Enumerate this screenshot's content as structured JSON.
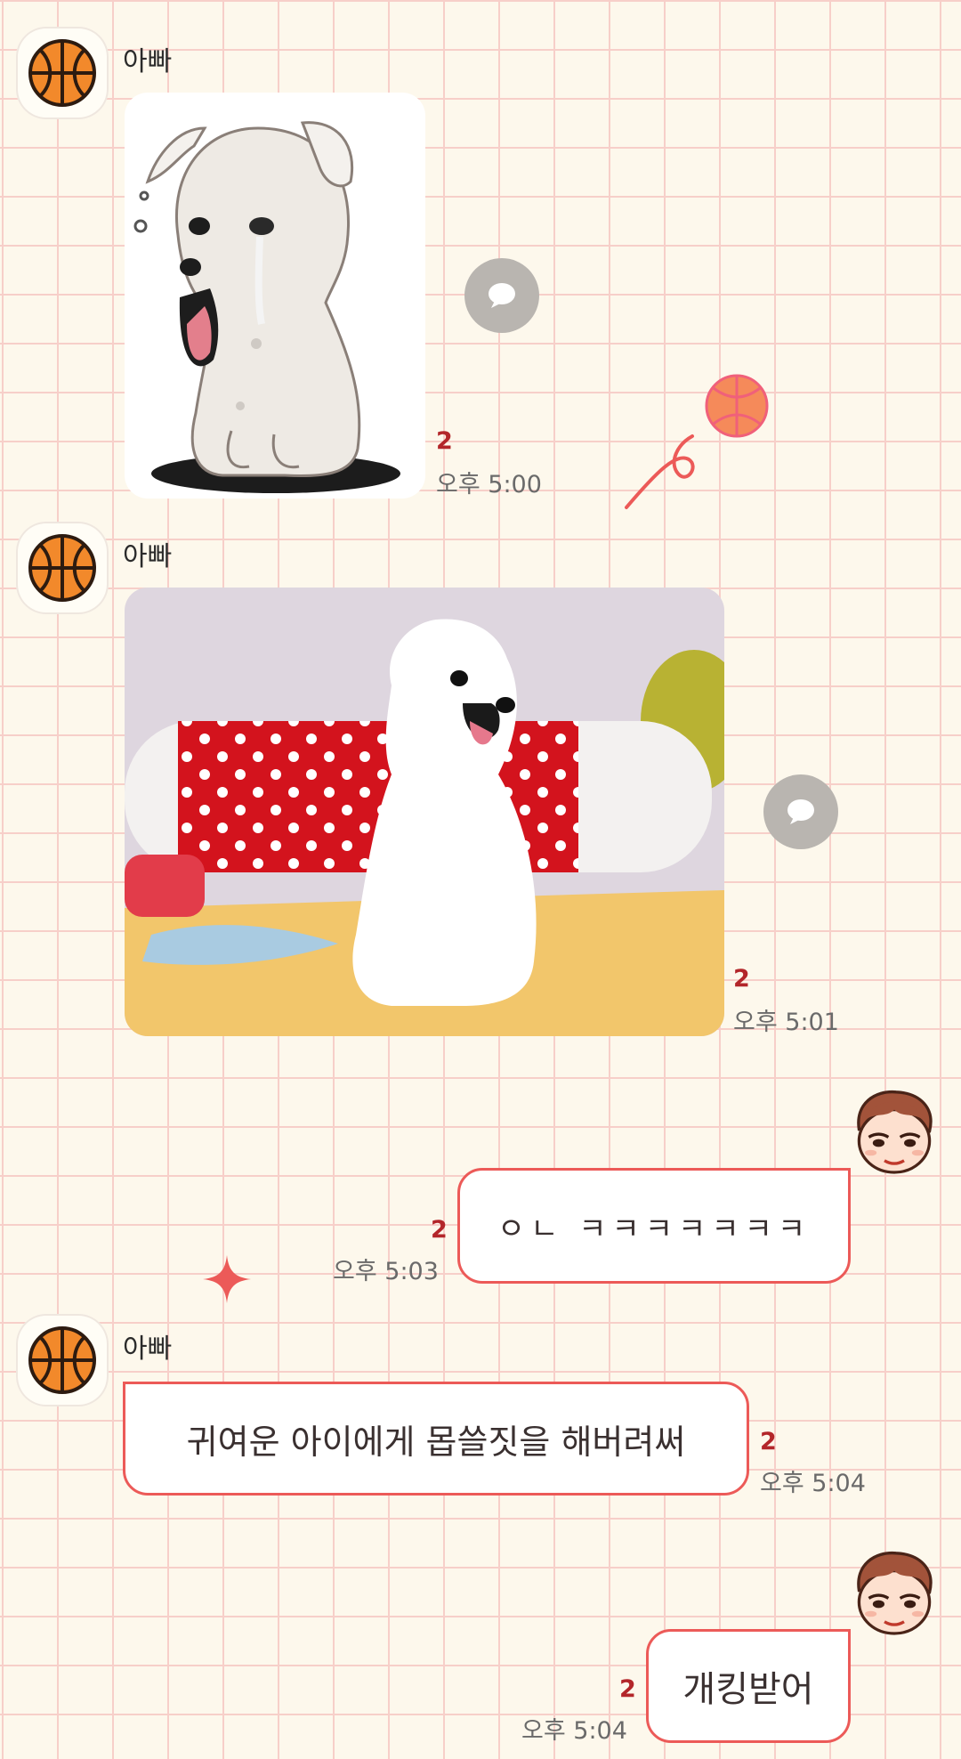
{
  "messages": [
    {
      "sender": "아빠",
      "type": "image",
      "content": "crying-puppy-sticker",
      "unread": "2",
      "time": "오후 5:00"
    },
    {
      "sender": "아빠",
      "type": "image",
      "content": "white-puppy-photo",
      "unread": "2",
      "time": "오후 5:01"
    },
    {
      "sender": "me",
      "type": "text",
      "text": "ㅇㄴ ㅋㅋㅋㅋㅋㅋㅋ",
      "unread": "2",
      "time": "오후 5:03"
    },
    {
      "sender": "아빠",
      "type": "text",
      "text": "귀여운 아이에게 몹쓸짓을 해버려써",
      "unread": "2",
      "time": "오후 5:04"
    },
    {
      "sender": "me",
      "type": "text",
      "text": "개킹받어",
      "unread": "2",
      "time": "오후 5:04"
    }
  ],
  "icons": {
    "dad_avatar": "basketball-icon",
    "my_avatar": "cartoon-boy-icon",
    "share": "speech-bubble-icon",
    "decor": [
      "basketball-doodle-icon",
      "sparkle-icon"
    ]
  },
  "colors": {
    "accent": "#ec5a58",
    "unread": "#b3262a",
    "grid": "#f7cfc9",
    "background": "#fdf8ec"
  }
}
